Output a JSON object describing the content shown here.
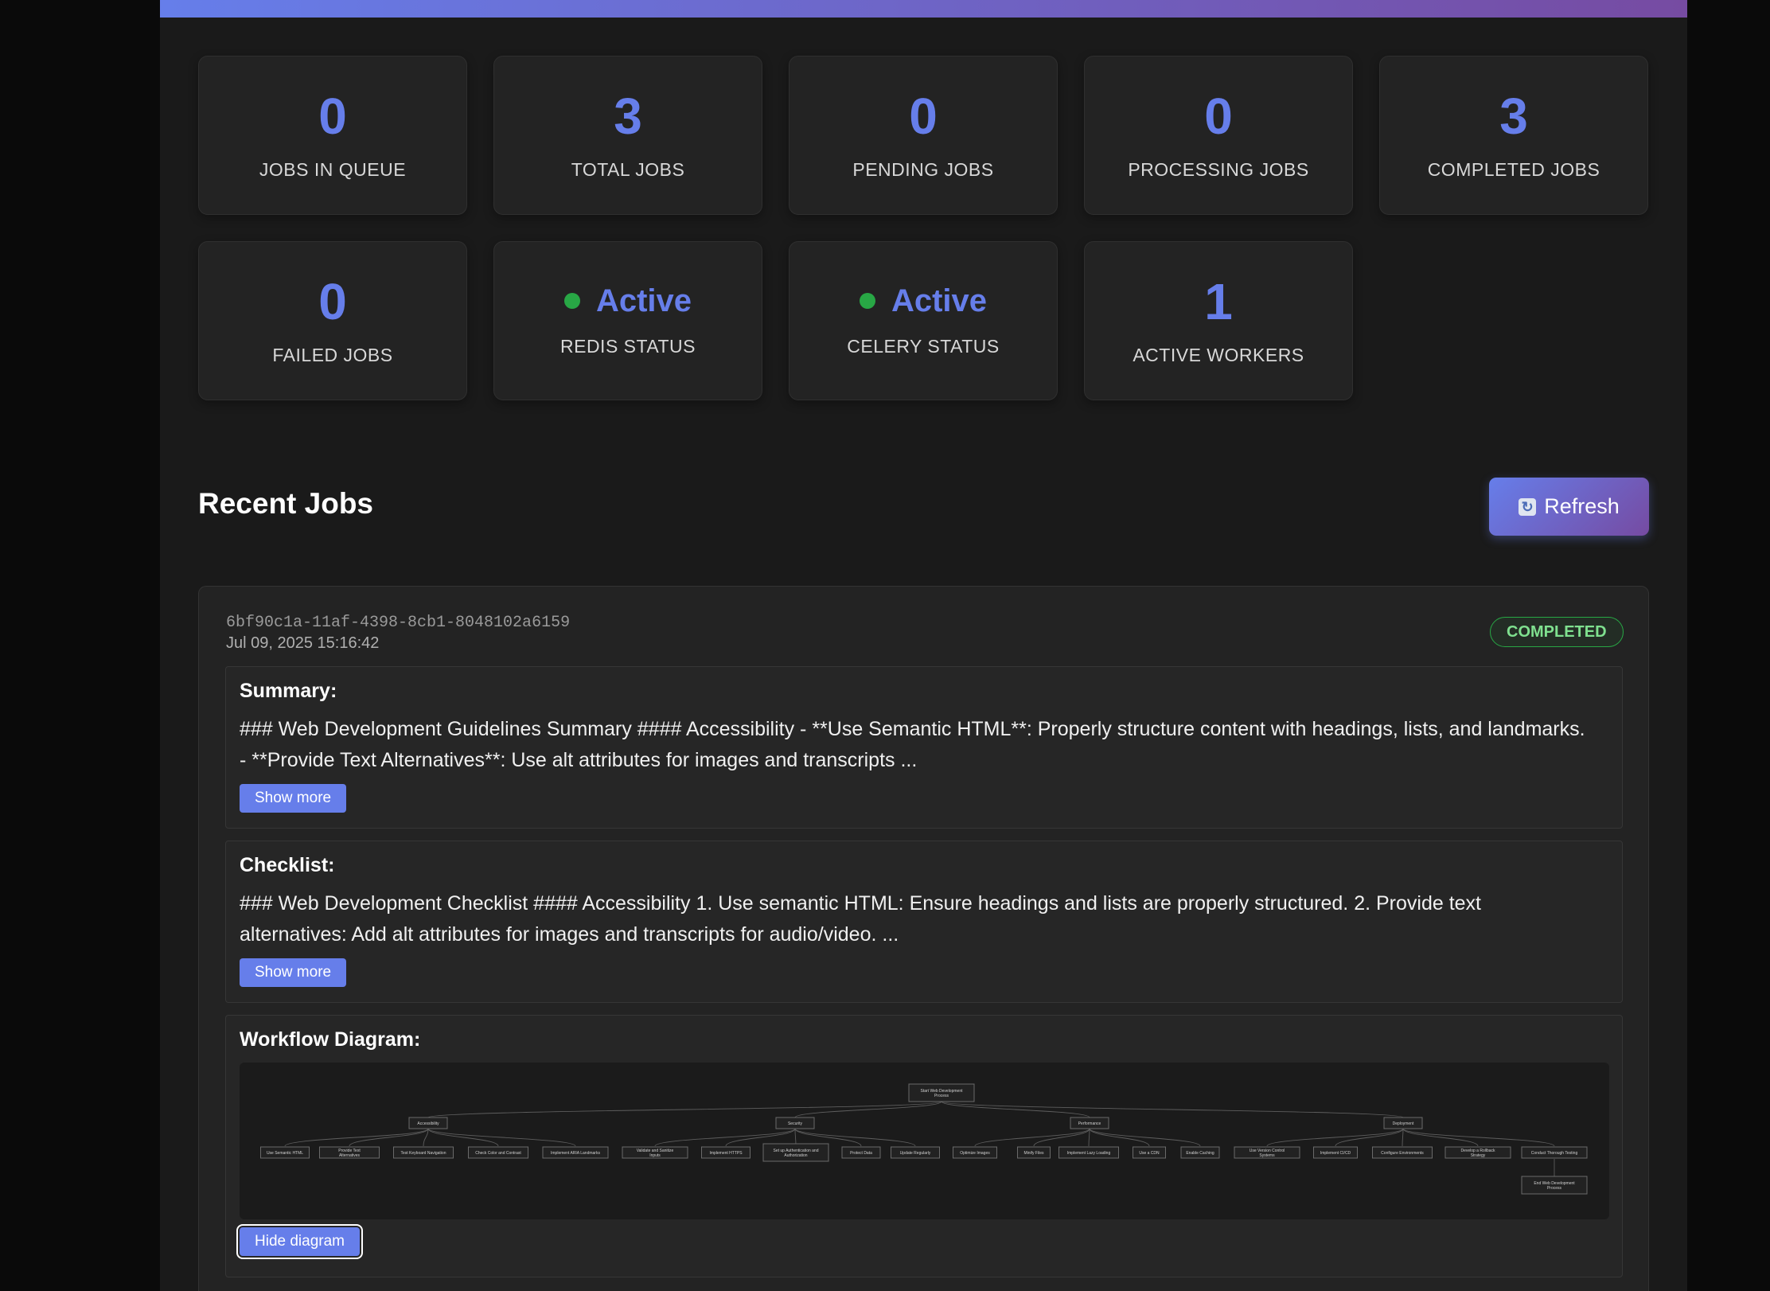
{
  "stats": [
    {
      "value": "0",
      "label": "Jobs in Queue"
    },
    {
      "value": "3",
      "label": "Total Jobs"
    },
    {
      "value": "0",
      "label": "Pending Jobs"
    },
    {
      "value": "0",
      "label": "Processing Jobs"
    },
    {
      "value": "3",
      "label": "Completed Jobs"
    },
    {
      "value": "0",
      "label": "Failed Jobs"
    },
    {
      "value": "Active",
      "label": "Redis Status",
      "dot_color": "#28a745"
    },
    {
      "value": "Active",
      "label": "Celery Status",
      "dot_color": "#28a745"
    },
    {
      "value": "1",
      "label": "Active Workers"
    }
  ],
  "colors": {
    "accent": "#667eea",
    "gradient_end": "#764ba2",
    "success": "#28a745"
  },
  "recent_jobs": {
    "title": "Recent Jobs",
    "refresh_label": "Refresh",
    "refresh_icon": "refresh-icon"
  },
  "job": {
    "id": "6bf90c1a-11af-4398-8cb1-8048102a6159",
    "timestamp": "Jul 09, 2025 15:16:42",
    "status": "COMPLETED",
    "summary": {
      "title": "Summary:",
      "text": "### Web Development Guidelines Summary #### Accessibility - **Use Semantic HTML**: Properly structure content with headings, lists, and landmarks. - **Provide Text Alternatives**: Use alt attributes for images and transcripts ...",
      "button": "Show more"
    },
    "checklist": {
      "title": "Checklist:",
      "text": "### Web Development Checklist #### Accessibility 1. Use semantic HTML: Ensure headings and lists are properly structured. 2. Provide text alternatives: Add alt attributes for images and transcripts for audio/video. ...",
      "button": "Show more"
    },
    "diagram": {
      "title": "Workflow Diagram:",
      "button": "Hide diagram",
      "root": "Start Web Development Process",
      "end": "End Web Development Process",
      "groups": [
        {
          "name": "Accessibility",
          "items": [
            "Use Semantic HTML",
            "Provide Text Alternatives",
            "Test Keyboard Navigation",
            "Check Color and Contrast",
            "Implement ARIA Landmarks"
          ]
        },
        {
          "name": "Security",
          "items": [
            "Validate and Sanitize Inputs",
            "Implement HTTPS",
            "Set up Authentication and Authorization",
            "Protect Data",
            "Update Regularly"
          ]
        },
        {
          "name": "Performance",
          "items": [
            "Optimize Images",
            "Minify Files",
            "Implement Lazy Loading",
            "Use a CDN",
            "Enable Caching"
          ]
        },
        {
          "name": "Deployment",
          "items": [
            "Use Version Control Systems",
            "Implement CI/CD",
            "Configure Environments",
            "Develop a Rollback Strategy",
            "Conduct Thorough Testing"
          ]
        }
      ]
    }
  }
}
